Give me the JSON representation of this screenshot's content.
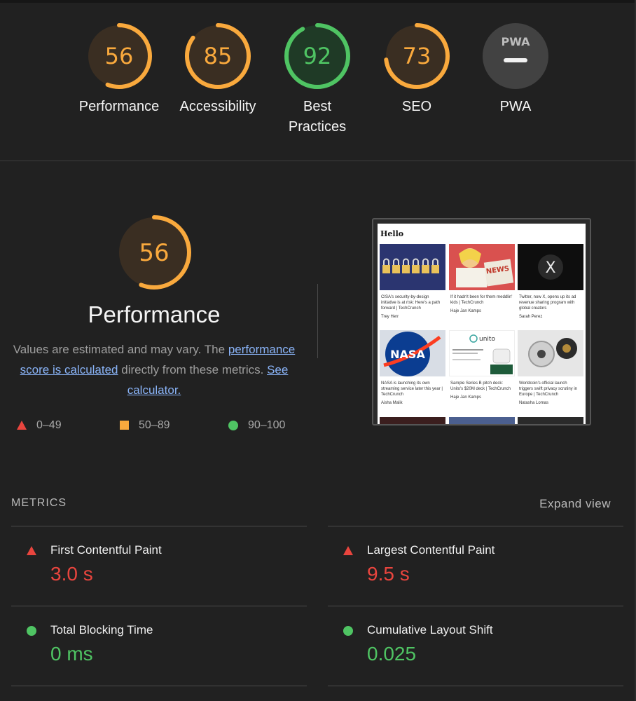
{
  "categories": [
    {
      "label": "Performance",
      "score": "56",
      "value": 56,
      "color": "#f9a93d",
      "icon": "score-gauge"
    },
    {
      "label": "Accessibility",
      "score": "85",
      "value": 85,
      "color": "#f9a93d",
      "icon": "score-gauge"
    },
    {
      "label": "Best\nPractices",
      "score": "92",
      "value": 92,
      "color": "#4fc463",
      "icon": "score-gauge"
    },
    {
      "label": "SEO",
      "score": "73",
      "value": 73,
      "color": "#f9a93d",
      "icon": "score-gauge"
    },
    {
      "label": "PWA",
      "badge": "PWA",
      "icon": "pwa-badge-icon"
    }
  ],
  "performance": {
    "score": "56",
    "value": 56,
    "title": "Performance",
    "desc_prefix": "Values are estimated and may vary. The ",
    "desc_link1": "performance score is calculated",
    "desc_mid": " directly from these metrics. ",
    "desc_link2": "See calculator."
  },
  "legend": [
    {
      "range": "0–49",
      "icon": "red-triangle-icon",
      "color": "#e9453e"
    },
    {
      "range": "50–89",
      "icon": "orange-square-icon",
      "color": "#f9a93d"
    },
    {
      "range": "90–100",
      "icon": "green-circle-icon",
      "color": "#4fc463"
    }
  ],
  "screenshot": {
    "heading": "Hello",
    "cards": [
      {
        "title": "CISA's security-by-design initiative is at risk: Here's a path forward | TechCrunch",
        "author": "Trey Herr",
        "icon": "padlocks-image"
      },
      {
        "title": "If it hadn't been for them meddlin' kids | TechCrunch",
        "author": "Haje Jan Kamps",
        "icon": "comic-newspaper-image",
        "img_text": "NEWS"
      },
      {
        "title": "Twitter, now X, opens up its ad revenue sharing program with global creators",
        "author": "Sarah Perez",
        "icon": "x-logo-image",
        "img_text": "X"
      },
      {
        "title": "NASA is launching its own streaming service later this year | TechCrunch",
        "author": "Aisha Malik",
        "icon": "nasa-logo-image",
        "img_text": "NASA"
      },
      {
        "title": "Sample Series B pitch deck: Unito's $20M deck | TechCrunch",
        "author": "Haje Jan Kamps",
        "icon": "unito-image",
        "img_text": "unito"
      },
      {
        "title": "Worldcoin's official launch triggers swift privacy scrutiny in Europe | TechCrunch",
        "author": "Natasha Lomas",
        "icon": "orb-device-image"
      }
    ]
  },
  "metrics": {
    "heading": "METRICS",
    "expand_label": "Expand view",
    "items": [
      {
        "name": "First Contentful Paint",
        "value": "3.0 s",
        "color": "#e9453e",
        "icon": "red-triangle-icon"
      },
      {
        "name": "Largest Contentful Paint",
        "value": "9.5 s",
        "color": "#e9453e",
        "icon": "red-triangle-icon"
      },
      {
        "name": "Total Blocking Time",
        "value": "0 ms",
        "color": "#4fc463",
        "icon": "green-circle-icon"
      },
      {
        "name": "Cumulative Layout Shift",
        "value": "0.025",
        "color": "#4fc463",
        "icon": "green-circle-icon"
      }
    ]
  }
}
